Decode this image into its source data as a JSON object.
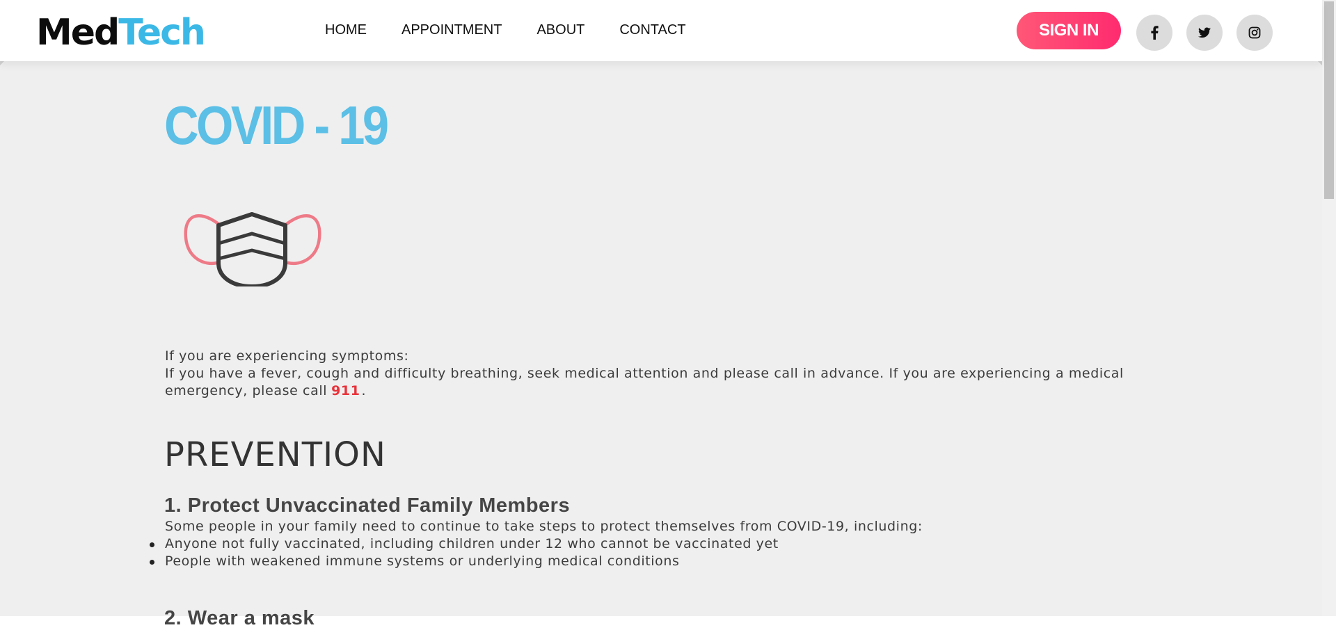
{
  "brand": {
    "logo_part1": "Med",
    "logo_part2": "Tech"
  },
  "nav": {
    "links": [
      "HOME",
      "APPOINTMENT",
      "ABOUT",
      "CONTACT"
    ],
    "signin_label": "SIGN IN",
    "social": [
      "facebook-icon",
      "twitter-icon",
      "instagram-icon"
    ]
  },
  "main": {
    "title": "COVID - 19",
    "intro_line1": "If you are experiencing symptoms:",
    "intro_line2_before": "If you have a fever, cough and difficulty breathing, seek medical attention and please call in advance. If you are experiencing a medical emergency, please call",
    "emergency_number": "911",
    "intro_line2_after": ".",
    "prevention_title": "PREVENTION",
    "sections": [
      {
        "title": "1. Protect Unvaccinated Family Members",
        "description": "Some people in your family need to continue to take steps to protect themselves from COVID-19, including:",
        "bullets": [
          "Anyone not fully vaccinated, including children under 12 who cannot be vaccinated yet",
          "People with weakened immune systems or underlying medical conditions"
        ]
      },
      {
        "title": "2. Wear a mask"
      }
    ]
  },
  "colors": {
    "accent_blue": "#5bbfe6",
    "signin_pink": "#ff3d73",
    "emergency_red": "#e8323a",
    "mask_strap": "#ee7a87",
    "mask_body": "#3a3a3a",
    "content_bg": "#efefef"
  }
}
